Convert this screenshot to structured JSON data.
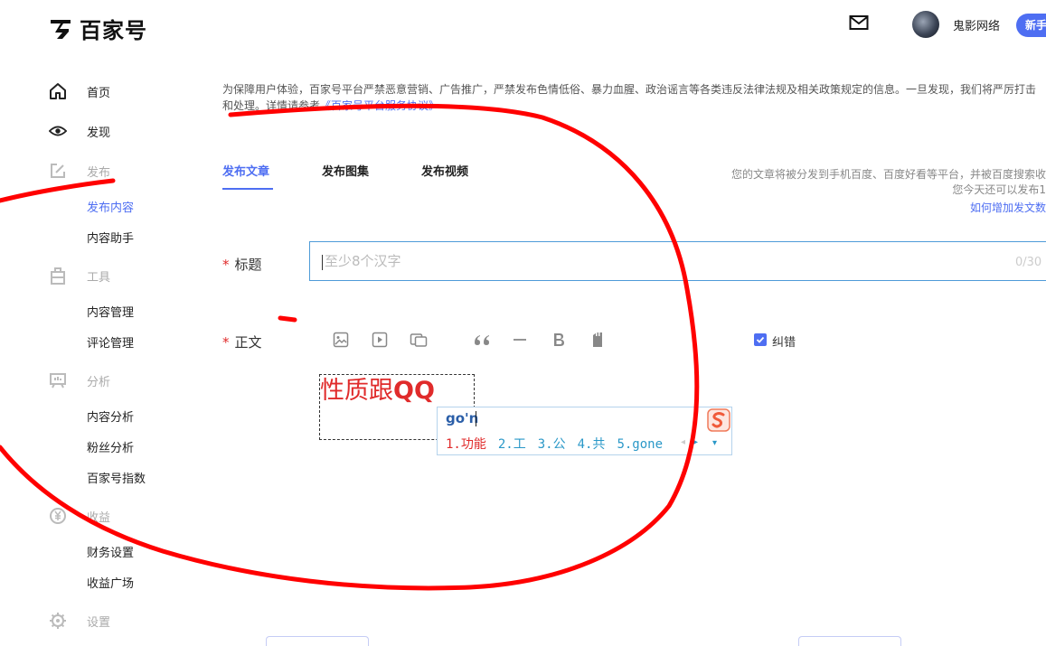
{
  "header": {
    "logo_text": "百家号",
    "username": "鬼影网络",
    "new_button": "新手"
  },
  "sidebar": {
    "home": "首页",
    "discover": "发现",
    "publish": "发布",
    "publish_content": "发布内容",
    "content_assistant": "内容助手",
    "tools": "工具",
    "content_management": "内容管理",
    "comment_management": "评论管理",
    "analysis": "分析",
    "content_analysis": "内容分析",
    "fan_analysis": "粉丝分析",
    "bjh_index": "百家号指数",
    "income": "收益",
    "finance_settings": "财务设置",
    "income_plaza": "收益广场",
    "settings": "设置"
  },
  "notice": {
    "text": "为保障用户体验，百家号平台严禁恶意营销、广告推广，严禁发布色情低俗、暴力血腥、政治谣言等各类违反法律法规及相关政策规定的信息。一旦发现，我们将严厉打击和处理。详情请参考",
    "link": "《百家号平台服务协议》"
  },
  "tabs": [
    "发布文章",
    "发布图集",
    "发布视频"
  ],
  "info": {
    "line1": "您的文章将被分发到手机百度、百度好看等平台，并被百度搜索收",
    "line2": "您今天还可以发布1",
    "link": "如何增加发文数"
  },
  "form": {
    "title_label": "标题",
    "title_placeholder": "至少8个汉字",
    "title_counter": "0/30",
    "body_label": "正文",
    "required_mark": "*",
    "correction_label": "纠错"
  },
  "editor": {
    "text_main": "性质跟",
    "text_qq": "QQ"
  },
  "ime": {
    "composition": "go'n",
    "candidates": [
      "1.功能",
      "2.工",
      "3.公",
      "4.共",
      "5.gone"
    ],
    "prev": "◂",
    "next": "▸",
    "more": "▾"
  }
}
